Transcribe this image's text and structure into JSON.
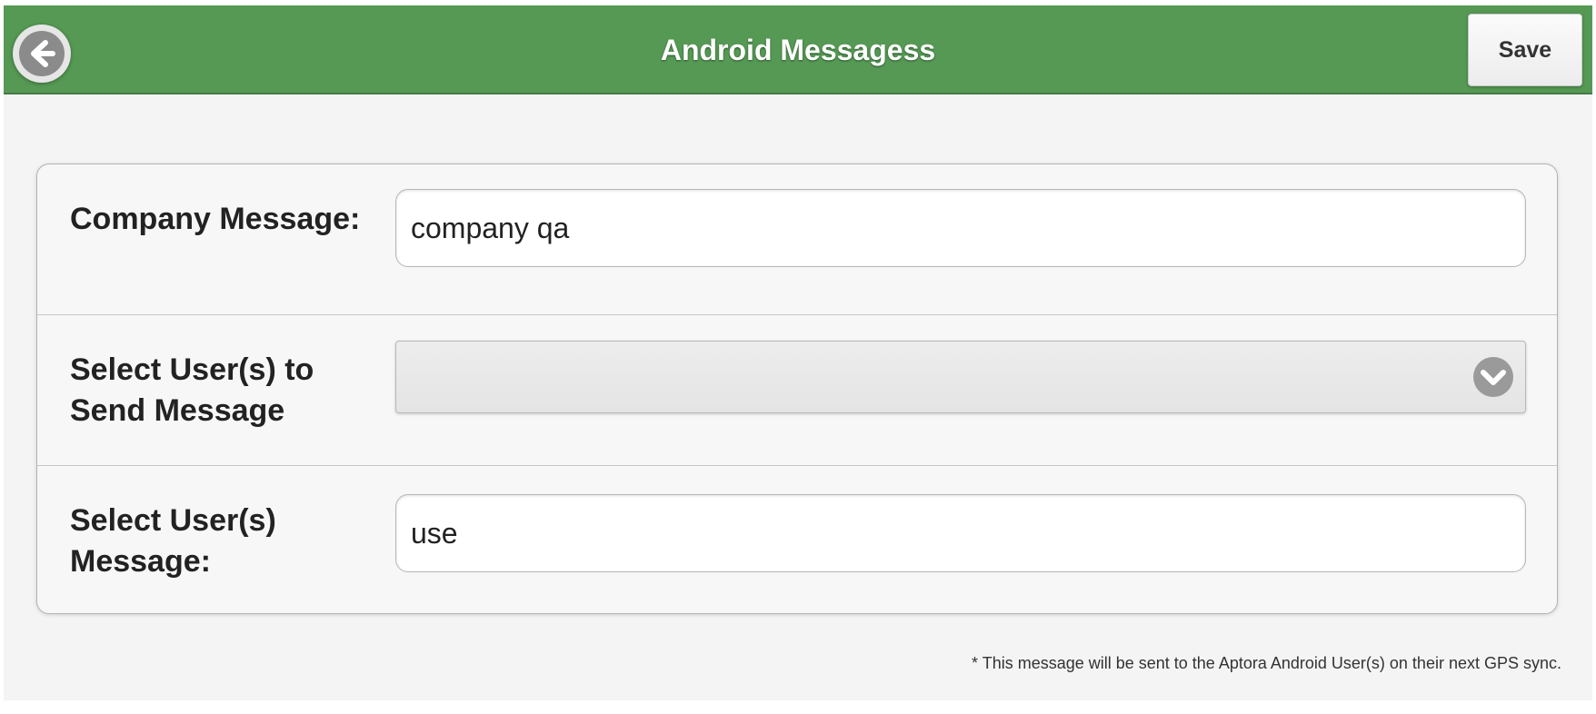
{
  "header": {
    "title": "Android Messagess",
    "save_label": "Save",
    "back_icon": "arrow-left-circle-icon",
    "color": "#559954"
  },
  "form": {
    "company_message": {
      "label": "Company Message:",
      "value": "company qa"
    },
    "select_users": {
      "label": "Select User(s) to Send Message",
      "value": "",
      "icon": "chevron-down-icon"
    },
    "users_message": {
      "label": "Select User(s) Message:",
      "value": "use"
    }
  },
  "footnote": "* This message will be sent to the Aptora Android User(s) on their next GPS sync."
}
